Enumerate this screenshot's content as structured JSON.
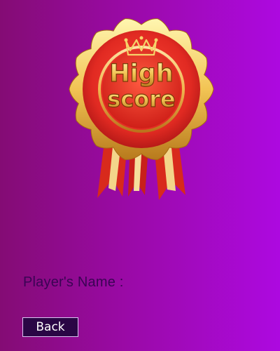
{
  "badge": {
    "line1": "High",
    "line2": "score",
    "icon": "crown-icon"
  },
  "player_label": "Player's Name :",
  "back_label": "Back",
  "colors": {
    "background_left": "#840c74",
    "background_right": "#ad09e0",
    "rosette_red": "#e12a22",
    "gold": "#f2c454",
    "button_bg": "#2a0645"
  }
}
